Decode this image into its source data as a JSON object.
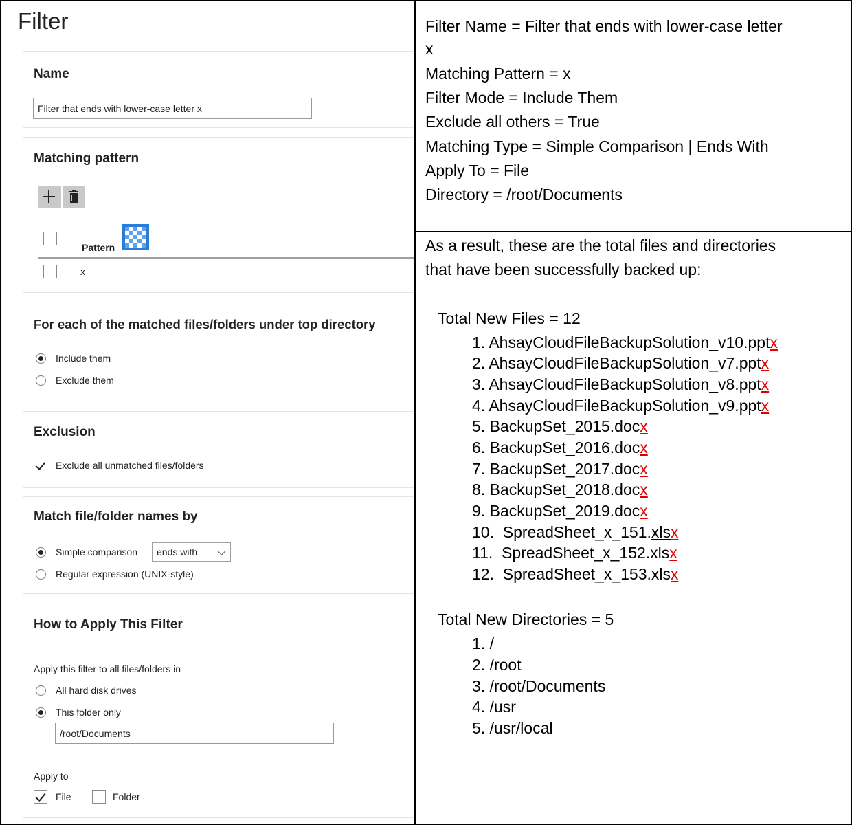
{
  "left": {
    "page_title": "Filter",
    "name_section": {
      "title": "Name",
      "value": "Filter that ends with lower-case letter x"
    },
    "pattern_section": {
      "title": "Matching pattern",
      "column_header": "Pattern",
      "rows": [
        "x"
      ]
    },
    "mode_section": {
      "title": "For each of the matched files/folders under top directory",
      "options": [
        "Include them",
        "Exclude them"
      ],
      "selected": "Include them"
    },
    "exclusion_section": {
      "title": "Exclusion",
      "checkbox_label": "Exclude all unmatched files/folders",
      "checked": true
    },
    "match_section": {
      "title": "Match file/folder names by",
      "simple_label": "Simple comparison",
      "simple_select_value": "ends with",
      "regex_label": "Regular expression (UNIX-style)",
      "selected": "Simple comparison"
    },
    "apply_section": {
      "title": "How to Apply This Filter",
      "apply_in_label": "Apply this filter to all files/folders in",
      "opt_all": "All hard disk drives",
      "opt_folder": "This folder only",
      "folder_value": "/root/Documents",
      "apply_to_label": "Apply to",
      "file_label": "File",
      "file_checked": true,
      "folder_label": "Folder",
      "folder_checked": false
    }
  },
  "right": {
    "summary": {
      "line1a": "Filter Name = Filter that ends with lower-case letter",
      "line1b": "x",
      "line2": "Matching Pattern = x",
      "line3": "Filter Mode = Include Them",
      "line4": "Exclude all others = True",
      "line5": "Matching Type = Simple Comparison | Ends With",
      "line6": "Apply To = File",
      "line7": "Directory = /root/Documents"
    },
    "result_intro_1": "As a result, these are the total files and directories",
    "result_intro_2": "that have been successfully backed up:",
    "files_heading": "Total New Files = 12",
    "files": [
      {
        "num": "1.",
        "stem": "AhsayCloudFileBackupSolution_v10.ppt",
        "end": "x"
      },
      {
        "num": "2.",
        "stem": "AhsayCloudFileBackupSolution_v7.ppt",
        "end": "x"
      },
      {
        "num": "3.",
        "stem": "AhsayCloudFileBackupSolution_v8.ppt",
        "end": "x"
      },
      {
        "num": "4.",
        "stem": "AhsayCloudFileBackupSolution_v9.ppt",
        "end": "x"
      },
      {
        "num": "5.",
        "stem": "BackupSet_2015.doc",
        "end": "x"
      },
      {
        "num": "6.",
        "stem": "BackupSet_2016.doc",
        "end": "x"
      },
      {
        "num": "7.",
        "stem": "BackupSet_2017.doc",
        "end": "x"
      },
      {
        "num": "8.",
        "stem": "BackupSet_2018.doc",
        "end": "x"
      },
      {
        "num": "9.",
        "stem": "BackupSet_2019.doc",
        "end": "x"
      },
      {
        "num": "10.",
        "stem_a": "SpreadSheet_x_151.",
        "stem_b": "xls",
        "end": "x"
      },
      {
        "num": "11.",
        "stem": "SpreadSheet_x_152.xls",
        "end": "x"
      },
      {
        "num": "12.",
        "stem": "SpreadSheet_x_153.xls",
        "end": "x"
      }
    ],
    "dirs_heading": "Total New Directories = 5",
    "dirs": [
      {
        "num": "1.",
        "path": "/"
      },
      {
        "num": "2.",
        "path": "/root"
      },
      {
        "num": "3.",
        "path": "/root/Documents"
      },
      {
        "num": "4.",
        "path": "/usr"
      },
      {
        "num": "5.",
        "path": "/usr/local"
      }
    ]
  }
}
